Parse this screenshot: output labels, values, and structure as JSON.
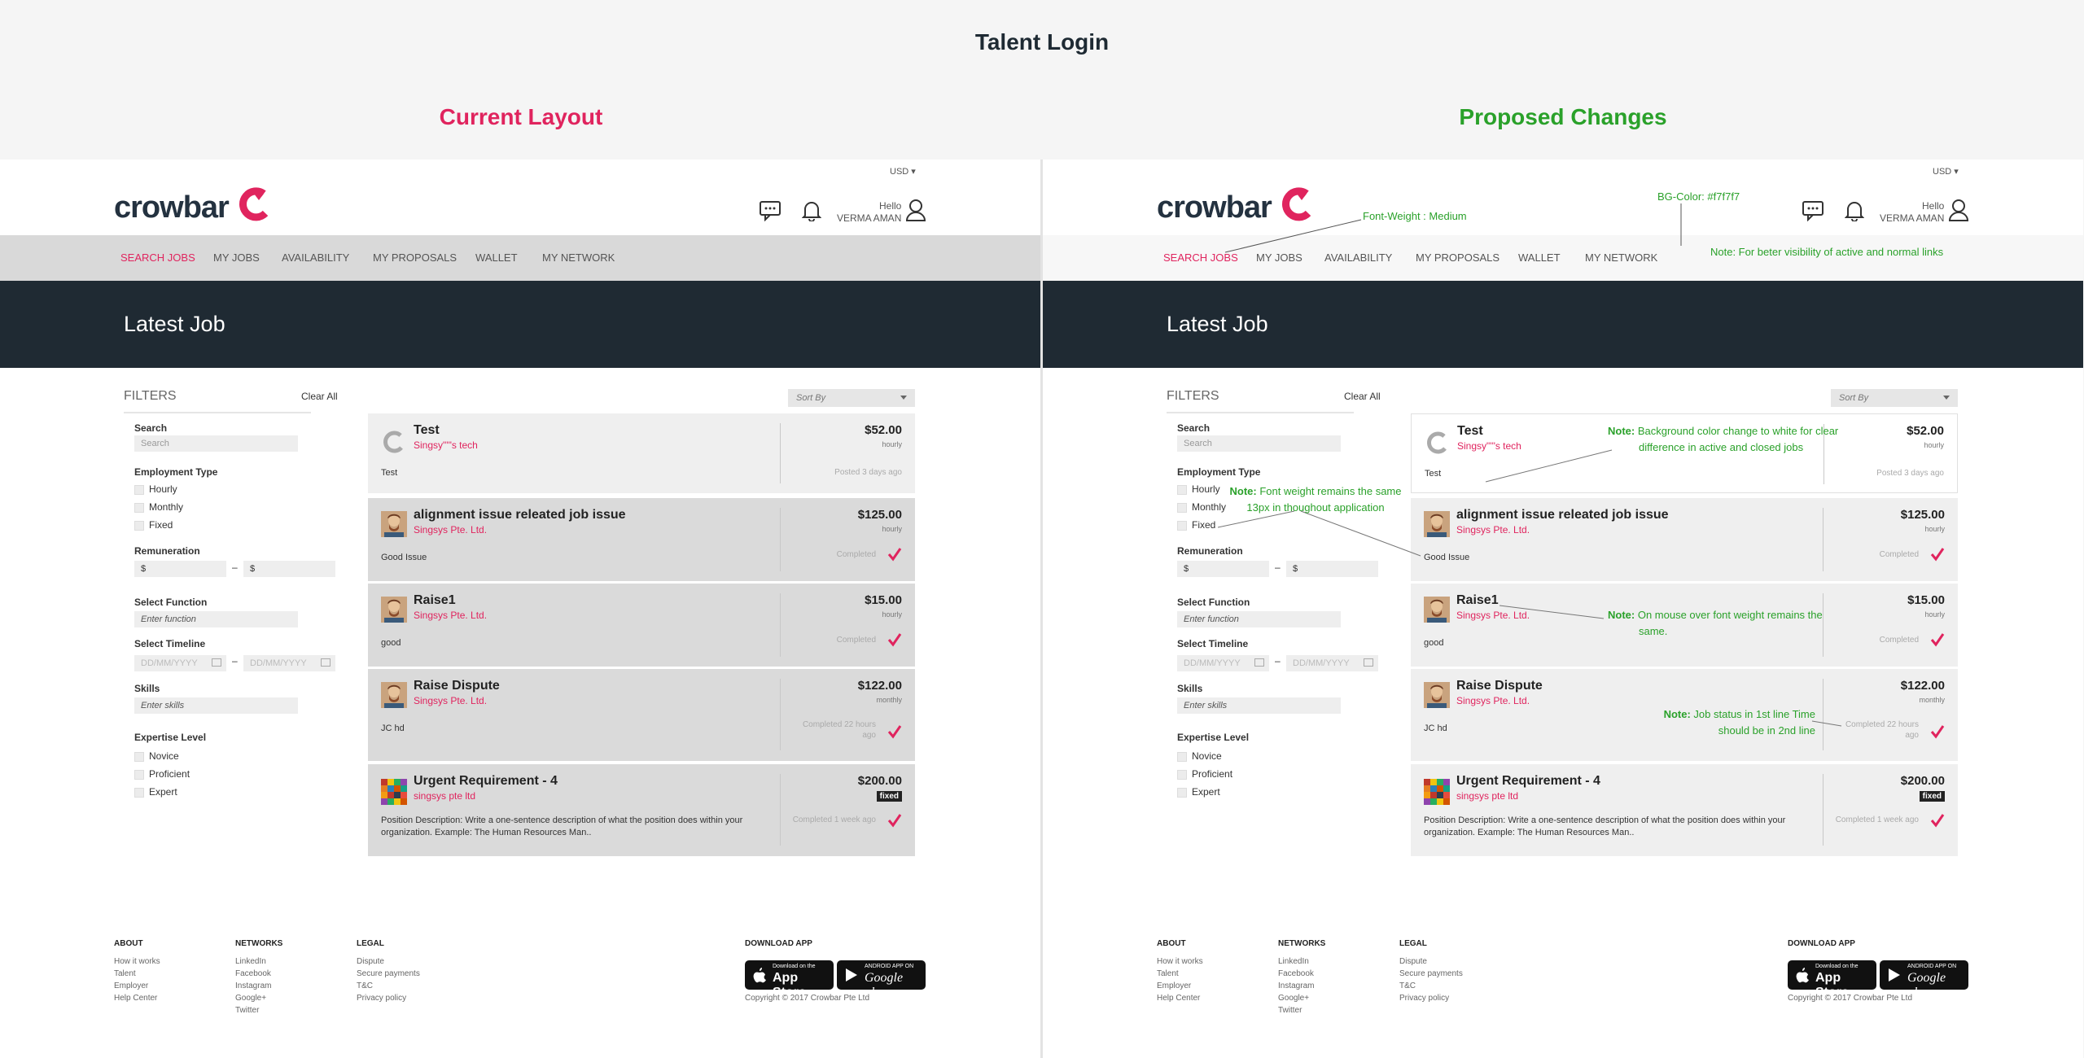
{
  "page_title": "Talent Login",
  "panels": {
    "left_title": "Current Layout",
    "right_title": "Proposed Changes"
  },
  "header": {
    "currency": "USD",
    "logo_text": "crowbar",
    "hello": "Hello",
    "user": "VERMA AMAN"
  },
  "nav": [
    "SEARCH JOBS",
    "MY JOBS",
    "AVAILABILITY",
    "MY PROPOSALS",
    "WALLET",
    "MY NETWORK"
  ],
  "banner_title": "Latest Job",
  "filters": {
    "heading": "FILTERS",
    "clear_all": "Clear All",
    "search_label": "Search",
    "search_placeholder": "Search",
    "employment_label": "Employment Type",
    "employment_options": [
      "Hourly",
      "Monthly",
      "Fixed"
    ],
    "remuneration_label": "Remuneration",
    "currency_symbol": "$",
    "range_dash": "–",
    "function_label": "Select Function",
    "function_placeholder": "Enter function",
    "timeline_label": "Select Timeline",
    "date_placeholder": "DD/MM/YYYY",
    "skills_label": "Skills",
    "skills_placeholder": "Enter skills",
    "expertise_label": "Expertise Level",
    "expertise_options": [
      "Novice",
      "Proficient",
      "Expert"
    ]
  },
  "sort_by": "Sort By",
  "jobs": [
    {
      "title": "Test",
      "company": "Singsy\"'\"s tech",
      "desc": "Test",
      "price": "$52.00",
      "rate": "hourly",
      "status": "Posted 3 days ago"
    },
    {
      "title": "alignment issue releated job issue",
      "company": "Singsys Pte. Ltd.",
      "desc": "Good Issue",
      "price": "$125.00",
      "rate": "hourly",
      "status": "Completed"
    },
    {
      "title": "Raise1",
      "company": "Singsys Pte. Ltd.",
      "desc": "good",
      "price": "$15.00",
      "rate": "hourly",
      "status": "Completed"
    },
    {
      "title": "Raise Dispute",
      "company": "Singsys Pte. Ltd.",
      "desc": "JC hd",
      "price": "$122.00",
      "rate": "monthly",
      "status": "Completed 22 hours ago"
    },
    {
      "title": "Urgent Requirement - 4",
      "company": "singsys pte ltd",
      "desc": "Position Description: Write a one-sentence description of what the position does within your organization. Example: The Human Resources Man..",
      "price": "$200.00",
      "rate": "fixed",
      "status": "Completed 1 week ago"
    }
  ],
  "footer": {
    "about": {
      "heading": "ABOUT",
      "links": [
        "How it works",
        "Talent",
        "Employer",
        "Help Center"
      ]
    },
    "networks": {
      "heading": "NETWORKS",
      "links": [
        "LinkedIn",
        "Facebook",
        "Instagram",
        "Google+",
        "Twitter"
      ]
    },
    "legal": {
      "heading": "LEGAL",
      "links": [
        "Dispute",
        "Secure payments",
        "T&C",
        "Privacy policy"
      ]
    },
    "download": {
      "heading": "DOWNLOAD APP",
      "appstore_small": "Download on the",
      "appstore_big": "App Store",
      "google_small": "ANDROID APP ON",
      "google_big": "Google play"
    },
    "copyright": "Copyright © 2017 Crowbar Pte Ltd"
  },
  "annotations": {
    "font_weight": "Font-Weight : Medium",
    "bg_color": "BG-Color: #f7f7f7",
    "nav_note": "Note: For beter visibility of active and normal links",
    "note_label": "Note:",
    "bg_note": "Background color change to white for clear difference in active and closed jobs",
    "font_note": "Font weight remains the same 13px in thoughout application",
    "hover_note": "On mouse over font weight remains the same.",
    "status_note": "Job status in 1st line Time should be in 2nd line"
  },
  "colors": {
    "accent": "#e0245e",
    "annotation": "#2aa12a",
    "banner": "#1f2a33",
    "nav_current": "#d9d9d9",
    "nav_proposed": "#f7f7f7"
  }
}
